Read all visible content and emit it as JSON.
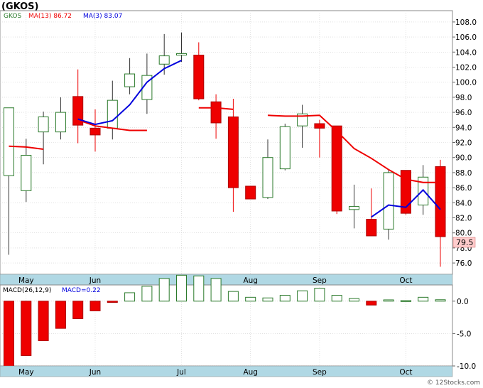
{
  "title": "(GKOS)",
  "watermark": "© 12Stocks.com",
  "colors": {
    "ma_fast": "#0000dd",
    "ma_slow": "#ee0000",
    "up": "#2b7a2b",
    "down": "#ee0000",
    "axis_band": "#b0d8e4",
    "price_badge": "#ffcccc"
  },
  "price_panel": {
    "legend_symbol": "GKOS",
    "legend_ma13": "MA(13)  86.72",
    "legend_ma3": "MA(3)  83.07",
    "y_ticks": [
      "108.0",
      "106.0",
      "104.0",
      "102.0",
      "100.0",
      "98.0",
      "96.0",
      "94.0",
      "92.0",
      "90.0",
      "88.0",
      "86.0",
      "84.0",
      "82.0",
      "80.0",
      "78.0",
      "76.0"
    ],
    "last_price_label": "79.5"
  },
  "macd_panel": {
    "legend_label": "MACD(26,12,9)",
    "legend_value": "MACD=0.22",
    "y_ticks": [
      "0.0",
      "-5.0",
      "-10.0"
    ]
  },
  "x_axis": {
    "month_labels": [
      "May",
      "Jun",
      "Jul",
      "Aug",
      "Sep",
      "Oct"
    ]
  },
  "chart_data": [
    {
      "type": "candlestick",
      "title": "(GKOS)",
      "ylim": [
        74.5,
        109.5
      ],
      "grid": true,
      "candles": [
        {
          "open": 87.6,
          "high": 94.0,
          "low": 77.1,
          "close": 96.6
        },
        {
          "open": 85.6,
          "high": 92.5,
          "low": 84.1,
          "close": 90.3
        },
        {
          "open": 93.4,
          "high": 96.1,
          "low": 89.1,
          "close": 95.4
        },
        {
          "open": 93.4,
          "high": 98.0,
          "low": 92.4,
          "close": 96.0
        },
        {
          "open": 98.1,
          "high": 101.7,
          "low": 91.9,
          "close": 94.3
        },
        {
          "open": 93.9,
          "high": 96.4,
          "low": 90.8,
          "close": 93.0
        },
        {
          "open": 93.9,
          "high": 100.2,
          "low": 92.4,
          "close": 97.6
        },
        {
          "open": 99.4,
          "high": 103.2,
          "low": 98.4,
          "close": 101.1
        },
        {
          "open": 97.7,
          "high": 103.8,
          "low": 95.8,
          "close": 100.9
        },
        {
          "open": 102.4,
          "high": 106.4,
          "low": 101.0,
          "close": 103.5
        },
        {
          "open": 103.6,
          "high": 106.6,
          "low": 102.7,
          "close": 103.8
        },
        {
          "open": 103.6,
          "high": 105.3,
          "low": 97.6,
          "close": 97.8
        },
        {
          "open": 97.4,
          "high": 98.4,
          "low": 92.5,
          "close": 94.6
        },
        {
          "open": 95.4,
          "high": 97.8,
          "low": 82.8,
          "close": 86.0
        },
        {
          "open": 86.2,
          "high": 86.2,
          "low": 84.5,
          "close": 84.5
        },
        {
          "open": 84.7,
          "high": 92.4,
          "low": 84.5,
          "close": 90.0
        },
        {
          "open": 88.5,
          "high": 94.5,
          "low": 88.3,
          "close": 94.1
        },
        {
          "open": 94.2,
          "high": 97.0,
          "low": 91.3,
          "close": 95.8
        },
        {
          "open": 94.5,
          "high": 95.0,
          "low": 90.0,
          "close": 93.9
        },
        {
          "open": 94.2,
          "high": 94.2,
          "low": 82.5,
          "close": 82.9
        },
        {
          "open": 83.1,
          "high": 86.4,
          "low": 80.6,
          "close": 83.5
        },
        {
          "open": 81.8,
          "high": 85.9,
          "low": 79.6,
          "close": 79.6
        },
        {
          "open": 80.5,
          "high": 88.4,
          "low": 79.1,
          "close": 88.0
        },
        {
          "open": 88.3,
          "high": 88.3,
          "low": 82.4,
          "close": 82.6
        },
        {
          "open": 83.7,
          "high": 89.0,
          "low": 82.4,
          "close": 87.4
        },
        {
          "open": 88.8,
          "high": 89.7,
          "low": 75.5,
          "close": 79.5
        }
      ],
      "series": [
        {
          "name": "MA(13)",
          "values": [
            91.5,
            91.4,
            91.1,
            null,
            95.0,
            94.2,
            93.9,
            93.6,
            93.6,
            null,
            null,
            96.6,
            96.6,
            96.4,
            null,
            95.6,
            95.5,
            95.5,
            95.6,
            93.5,
            91.2,
            89.9,
            88.4,
            87.1,
            86.7,
            86.7
          ]
        },
        {
          "name": "MA(3)",
          "values": [
            null,
            null,
            null,
            null,
            95.1,
            94.4,
            94.9,
            97.0,
            100.0,
            101.8,
            102.9,
            null,
            null,
            null,
            null,
            null,
            null,
            null,
            null,
            null,
            null,
            82.1,
            83.7,
            83.4,
            85.7,
            83.1
          ]
        }
      ]
    },
    {
      "type": "bar",
      "title": "MACD(26,12,9)",
      "ylim": [
        -10.0,
        2.5
      ],
      "values": [
        -10.3,
        -8.4,
        -6.1,
        -4.2,
        -2.7,
        -1.5,
        -0.2,
        1.3,
        2.3,
        3.5,
        4.0,
        3.9,
        3.5,
        1.5,
        0.6,
        0.5,
        0.9,
        1.6,
        2.0,
        0.9,
        0.4,
        -0.6,
        0.2,
        0.1,
        0.6,
        0.22
      ]
    }
  ]
}
